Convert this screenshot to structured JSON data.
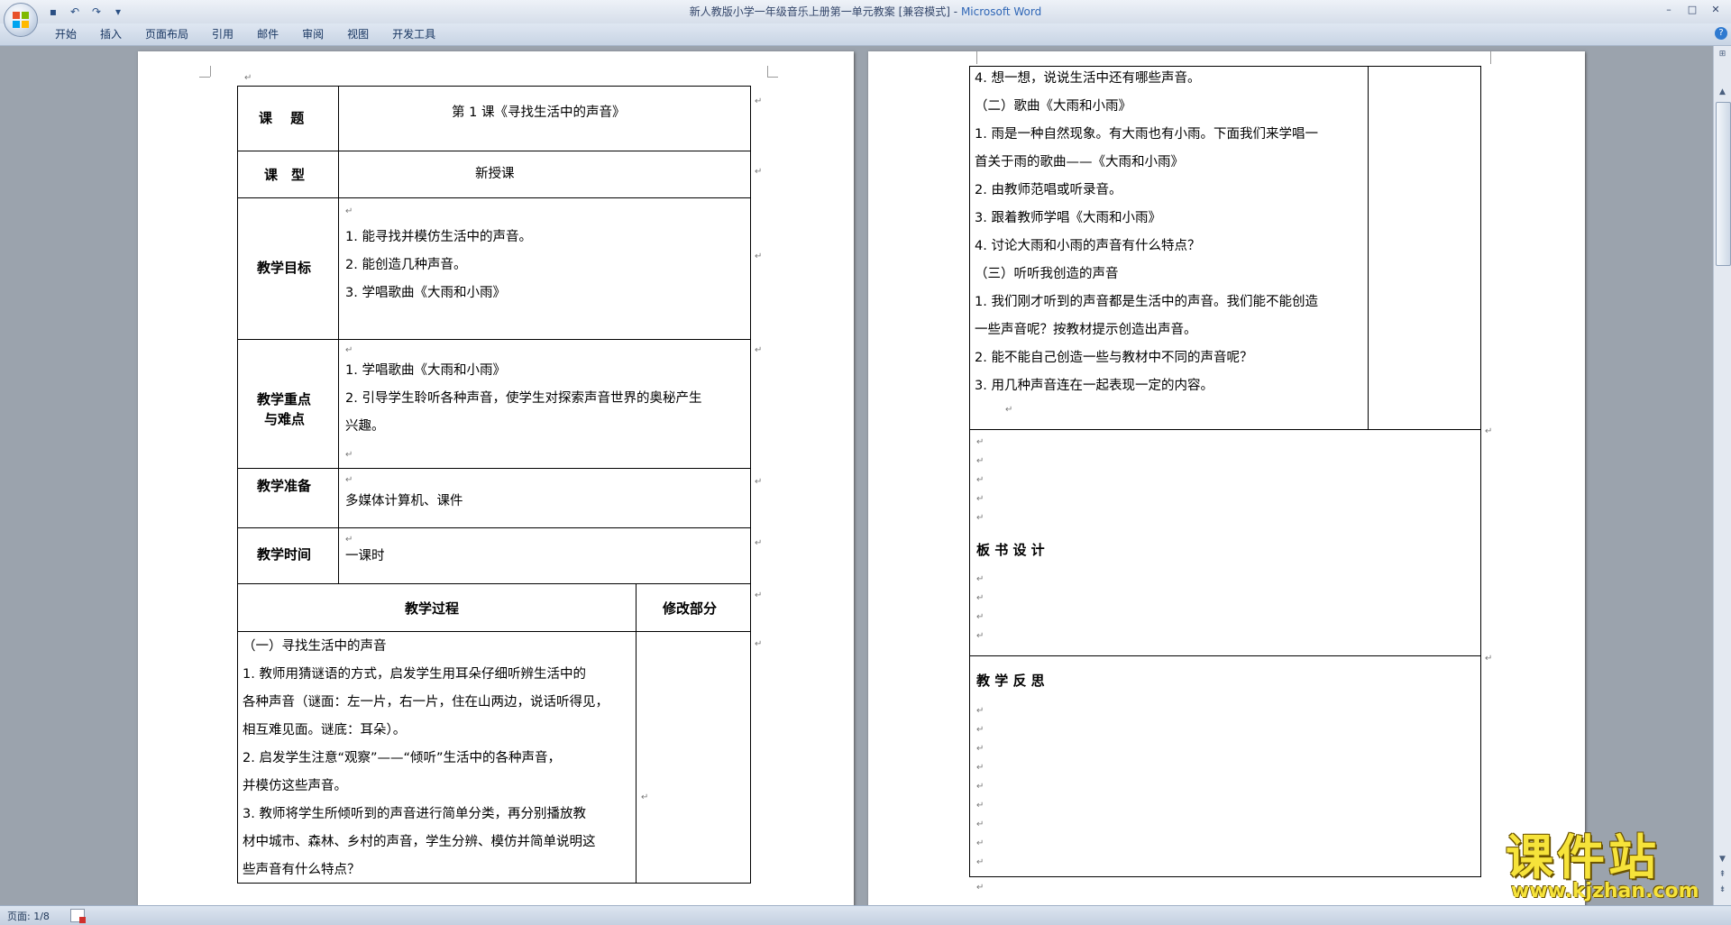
{
  "window": {
    "title": "新人教版小学一年级音乐上册第一单元教案 [兼容模式]",
    "title_sep": " - ",
    "app_name": "Microsoft Word",
    "minimize": "–",
    "maximize": "□",
    "close": "✕"
  },
  "quick_access": {
    "save": "▪",
    "undo": "↶",
    "redo": "↷",
    "customize": "▾"
  },
  "ribbon": {
    "tabs": [
      "开始",
      "插入",
      "页面布局",
      "引用",
      "邮件",
      "审阅",
      "视图",
      "开发工具"
    ],
    "help": "?"
  },
  "marks": {
    "para": "↵"
  },
  "page1": {
    "rows": {
      "topic_label": "课　 题",
      "topic_value": "第 1 课《寻找生活中的声音》",
      "type_label": "课　型",
      "type_value": "新授课",
      "goals_label": "教学目标",
      "goals": [
        "1. 能寻找并模仿生活中的声音。",
        "2. 能创造几种声音。",
        "3. 学唱歌曲《大雨和小雨》"
      ],
      "keys_label_1": "教学重点",
      "keys_label_2": "与难点",
      "keys": [
        "1. 学唱歌曲《大雨和小雨》",
        "2. 引导学生聆听各种声音，使学生对探索声音世界的奥秘产生",
        "兴趣。"
      ],
      "prep_label": "教学准备",
      "prep_value": "多媒体计算机、课件",
      "time_label": "教学时间",
      "time_value": "一课时",
      "process_label": "教学过程",
      "revise_label": "修改部分"
    },
    "process_lines": [
      "（一）寻找生活中的声音",
      "1. 教师用猜谜语的方式，启发学生用耳朵仔细听辨生活中的",
      "各种声音（谜面：左一片，右一片，住在山两边，说话听得见，",
      "相互难见面。谜底：耳朵）。",
      "2. 启发学生注意“观察”——“倾听”生活中的各种声音，",
      "并模仿这些声音。",
      "3. 教师将学生所倾听到的声音进行简单分类，再分别播放教",
      "材中城市、森林、乡村的声音，学生分辨、模仿并简单说明这",
      "些声音有什么特点？"
    ]
  },
  "page2": {
    "lines": [
      "4. 想一想，说说生活中还有哪些声音。",
      "（二）歌曲《大雨和小雨》",
      "1. 雨是一种自然现象。有大雨也有小雨。下面我们来学唱一",
      "首关于雨的歌曲——《大雨和小雨》",
      "2. 由教师范唱或听录音。",
      "3. 跟着教师学唱《大雨和小雨》",
      "4. 讨论大雨和小雨的声音有什么特点？",
      "（三）听听我创造的声音",
      "1. 我们刚才听到的声音都是生活中的声音。我们能不能创造",
      "一些声音呢？按教材提示创造出声音。",
      "2. 能不能自己创造一些与教材中不同的声音呢？",
      "3. 用几种声音连在一起表现一定的内容。"
    ],
    "board_label": "板 书 设 计",
    "reflect_label": "教 学 反 思"
  },
  "scrollbar": {
    "up": "▲",
    "down": "▼",
    "prev": "⇞",
    "next": "⇟",
    "ruler": "⊞"
  },
  "status": {
    "page_count": "页面: 1/8"
  },
  "watermark": {
    "cn": "课件站",
    "url": "www.kjzhan.com"
  }
}
